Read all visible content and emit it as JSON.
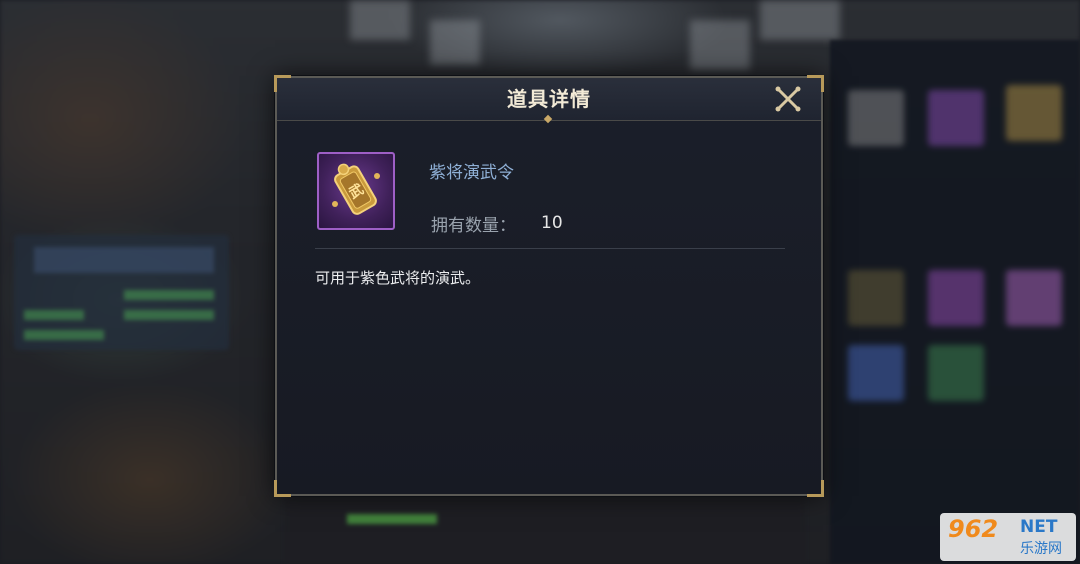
{
  "dialog": {
    "title": "道具详情",
    "close_icon": "close-x-icon",
    "item": {
      "icon": "purple-token-icon",
      "icon_glyph": "武",
      "rarity_color": "#9e5fc6",
      "name": "紫将演武令",
      "quantity_label": "拥有数量：",
      "quantity_value": "10"
    },
    "description": "可用于紫色武将的演武。"
  },
  "watermark": {
    "brand": "962",
    "suffix": "NET",
    "subtitle": "乐游网"
  },
  "colors": {
    "dialog_bg": "#1b1f2a",
    "frame": "#5b5a55",
    "accent_gold": "#b89a5a",
    "item_name": "#8fb0d6"
  }
}
